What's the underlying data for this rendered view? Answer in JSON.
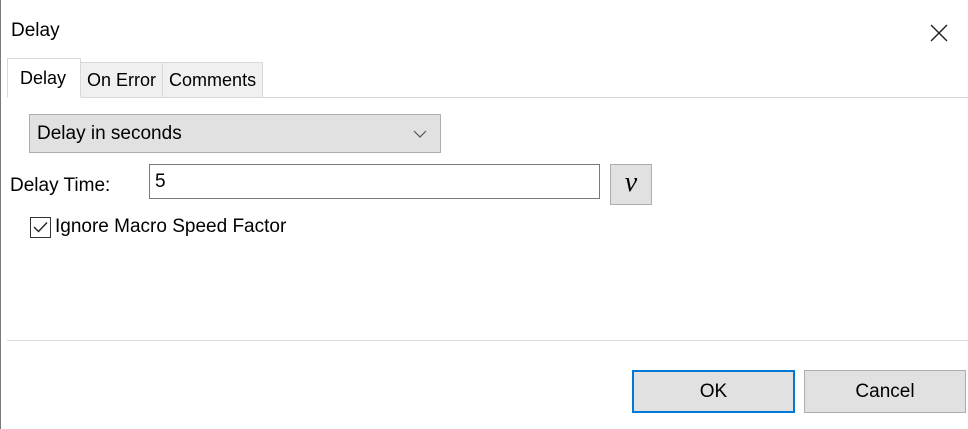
{
  "window": {
    "title": "Delay"
  },
  "tabs": [
    {
      "label": "Delay",
      "active": true
    },
    {
      "label": "On Error",
      "active": false
    },
    {
      "label": "Comments",
      "active": false
    }
  ],
  "delay_type": {
    "selected": "Delay in seconds"
  },
  "delay_time": {
    "label": "Delay Time:",
    "value": "5"
  },
  "variable_button": {
    "label": "v"
  },
  "ignore_speed": {
    "label": "Ignore Macro Speed Factor",
    "checked": true
  },
  "footer": {
    "ok_label": "OK",
    "cancel_label": "Cancel"
  },
  "colors": {
    "accent": "#0078d7",
    "button_face": "#e1e1e1",
    "border": "#adadad"
  },
  "icons": {
    "close": "close-icon",
    "dropdown_arrow": "chevron-down-icon",
    "checkmark": "checkmark-icon"
  }
}
